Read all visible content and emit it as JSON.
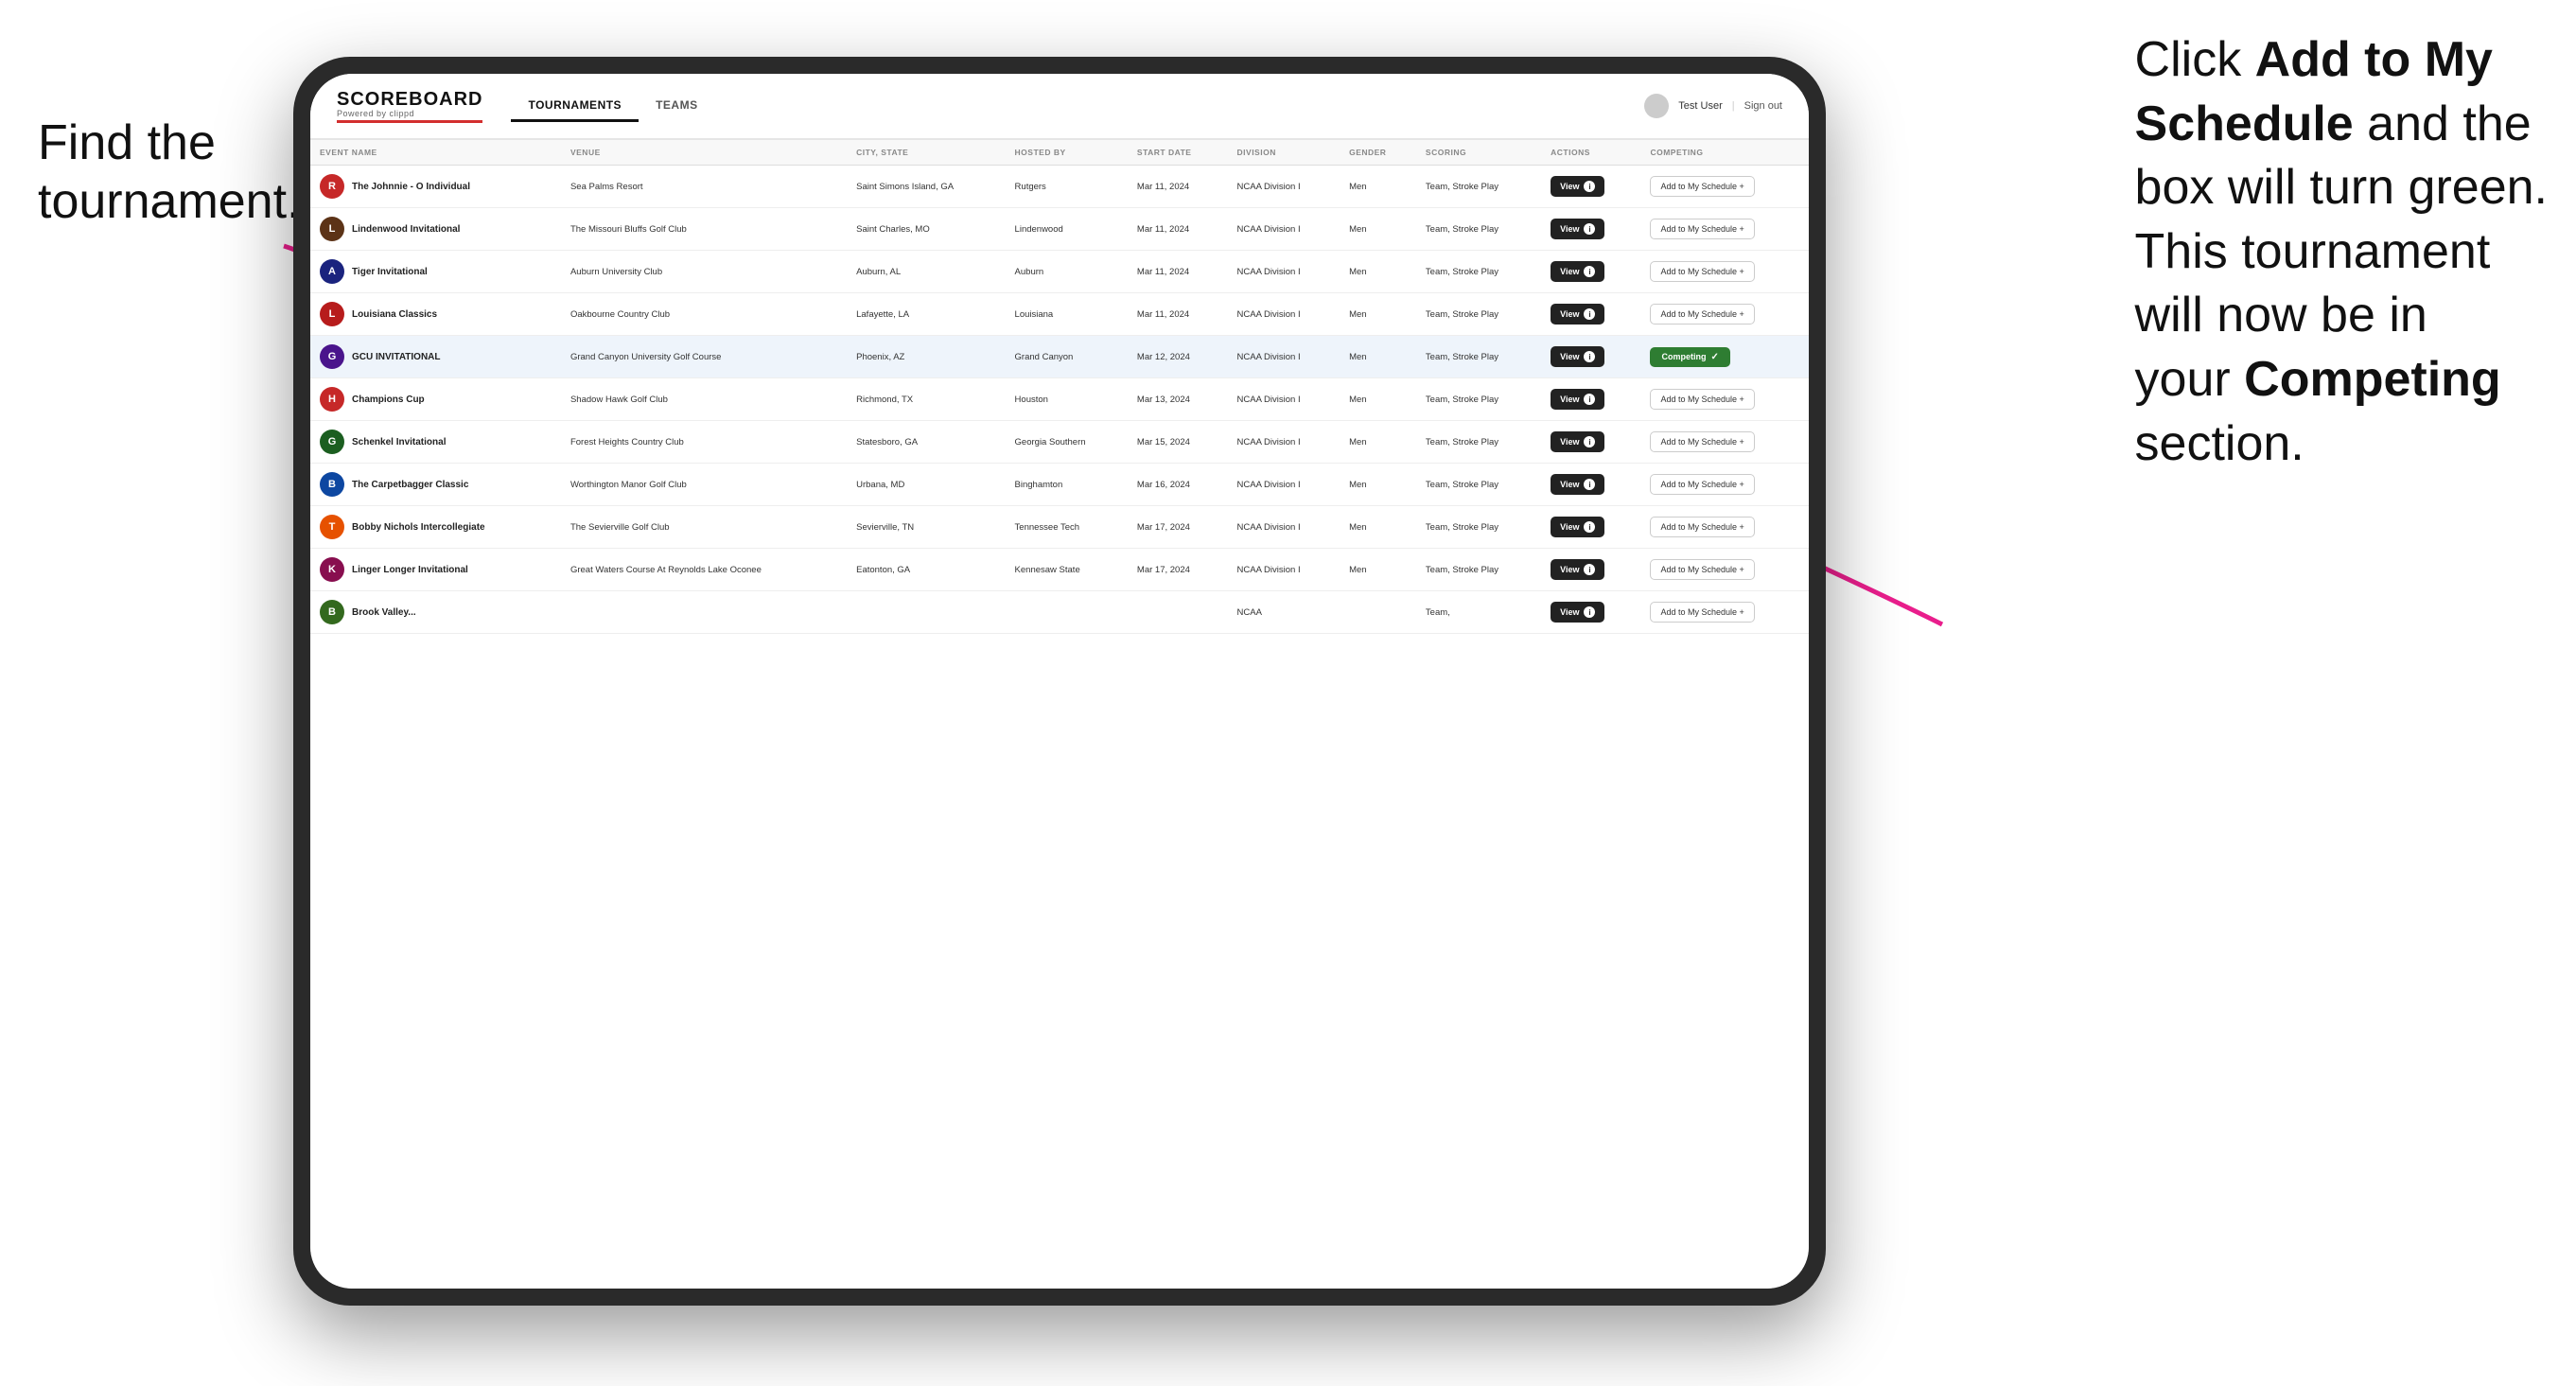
{
  "annotations": {
    "left": "Find the\ntournament.",
    "right_part1": "Click ",
    "right_bold1": "Add to My\nSchedule",
    "right_part2": " and the\nbox will turn green.\nThis tournament\nwill now be in\nyour ",
    "right_bold2": "Competing",
    "right_part3": "\nsection."
  },
  "header": {
    "logo": "SCOREBOARD",
    "logo_sub": "Powered by clippd",
    "nav_tabs": [
      "TOURNAMENTS",
      "TEAMS"
    ],
    "active_tab": "TOURNAMENTS",
    "user_label": "Test User",
    "sign_out_label": "Sign out"
  },
  "table": {
    "columns": [
      "EVENT NAME",
      "VENUE",
      "CITY, STATE",
      "HOSTED BY",
      "START DATE",
      "DIVISION",
      "GENDER",
      "SCORING",
      "ACTIONS",
      "COMPETING"
    ],
    "rows": [
      {
        "logo_color": "#c62828",
        "logo_letter": "R",
        "name": "The Johnnie - O Individual",
        "venue": "Sea Palms Resort",
        "city_state": "Saint Simons Island, GA",
        "hosted_by": "Rutgers",
        "start_date": "Mar 11, 2024",
        "division": "NCAA Division I",
        "gender": "Men",
        "scoring": "Team, Stroke Play",
        "competing": "add",
        "highlighted": false
      },
      {
        "logo_color": "#5c3317",
        "logo_letter": "L",
        "name": "Lindenwood Invitational",
        "venue": "The Missouri Bluffs Golf Club",
        "city_state": "Saint Charles, MO",
        "hosted_by": "Lindenwood",
        "start_date": "Mar 11, 2024",
        "division": "NCAA Division I",
        "gender": "Men",
        "scoring": "Team, Stroke Play",
        "competing": "add",
        "highlighted": false
      },
      {
        "logo_color": "#1a237e",
        "logo_letter": "A",
        "name": "Tiger Invitational",
        "venue": "Auburn University Club",
        "city_state": "Auburn, AL",
        "hosted_by": "Auburn",
        "start_date": "Mar 11, 2024",
        "division": "NCAA Division I",
        "gender": "Men",
        "scoring": "Team, Stroke Play",
        "competing": "add",
        "highlighted": false
      },
      {
        "logo_color": "#b71c1c",
        "logo_letter": "L",
        "name": "Louisiana Classics",
        "venue": "Oakbourne Country Club",
        "city_state": "Lafayette, LA",
        "hosted_by": "Louisiana",
        "start_date": "Mar 11, 2024",
        "division": "NCAA Division I",
        "gender": "Men",
        "scoring": "Team, Stroke Play",
        "competing": "add",
        "highlighted": false
      },
      {
        "logo_color": "#4a148c",
        "logo_letter": "G",
        "name": "GCU INVITATIONAL",
        "venue": "Grand Canyon University Golf Course",
        "city_state": "Phoenix, AZ",
        "hosted_by": "Grand Canyon",
        "start_date": "Mar 12, 2024",
        "division": "NCAA Division I",
        "gender": "Men",
        "scoring": "Team, Stroke Play",
        "competing": "competing",
        "highlighted": true
      },
      {
        "logo_color": "#c62828",
        "logo_letter": "H",
        "name": "Champions Cup",
        "venue": "Shadow Hawk Golf Club",
        "city_state": "Richmond, TX",
        "hosted_by": "Houston",
        "start_date": "Mar 13, 2024",
        "division": "NCAA Division I",
        "gender": "Men",
        "scoring": "Team, Stroke Play",
        "competing": "add",
        "highlighted": false
      },
      {
        "logo_color": "#1b5e20",
        "logo_letter": "G",
        "name": "Schenkel Invitational",
        "venue": "Forest Heights Country Club",
        "city_state": "Statesboro, GA",
        "hosted_by": "Georgia Southern",
        "start_date": "Mar 15, 2024",
        "division": "NCAA Division I",
        "gender": "Men",
        "scoring": "Team, Stroke Play",
        "competing": "add",
        "highlighted": false
      },
      {
        "logo_color": "#0d47a1",
        "logo_letter": "B",
        "name": "The Carpetbagger Classic",
        "venue": "Worthington Manor Golf Club",
        "city_state": "Urbana, MD",
        "hosted_by": "Binghamton",
        "start_date": "Mar 16, 2024",
        "division": "NCAA Division I",
        "gender": "Men",
        "scoring": "Team, Stroke Play",
        "competing": "add",
        "highlighted": false
      },
      {
        "logo_color": "#e65100",
        "logo_letter": "T",
        "name": "Bobby Nichols Intercollegiate",
        "venue": "The Sevierville Golf Club",
        "city_state": "Sevierville, TN",
        "hosted_by": "Tennessee Tech",
        "start_date": "Mar 17, 2024",
        "division": "NCAA Division I",
        "gender": "Men",
        "scoring": "Team, Stroke Play",
        "competing": "add",
        "highlighted": false
      },
      {
        "logo_color": "#880e4f",
        "logo_letter": "K",
        "name": "Linger Longer Invitational",
        "venue": "Great Waters Course At Reynolds Lake Oconee",
        "city_state": "Eatonton, GA",
        "hosted_by": "Kennesaw State",
        "start_date": "Mar 17, 2024",
        "division": "NCAA Division I",
        "gender": "Men",
        "scoring": "Team, Stroke Play",
        "competing": "add",
        "highlighted": false
      },
      {
        "logo_color": "#33691e",
        "logo_letter": "B",
        "name": "Brook Valley...",
        "venue": "",
        "city_state": "",
        "hosted_by": "",
        "start_date": "",
        "division": "NCAA",
        "gender": "",
        "scoring": "Team,",
        "competing": "add",
        "highlighted": false
      }
    ]
  },
  "buttons": {
    "view_label": "View",
    "add_label": "Add to My Schedule",
    "competing_label": "Competing"
  }
}
